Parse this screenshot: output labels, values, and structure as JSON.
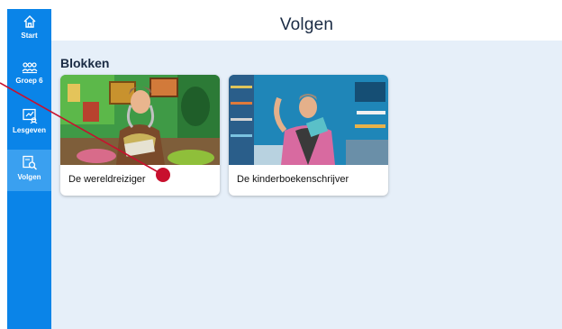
{
  "sidebar": {
    "items": [
      {
        "label": "Start",
        "icon": "home-icon"
      },
      {
        "label": "Groep 6",
        "icon": "group-icon"
      },
      {
        "label": "Lesgeven",
        "icon": "board-icon"
      },
      {
        "label": "Volgen",
        "icon": "search-doc-icon",
        "active": true
      }
    ]
  },
  "header": {
    "title": "Volgen"
  },
  "main": {
    "section_title": "Blokken",
    "cards": [
      {
        "title": "De wereldreiziger",
        "image": "woman in colorful room"
      },
      {
        "title": "De kinderboekenschrijver",
        "image": "man holding book in blue room"
      }
    ]
  },
  "colors": {
    "sidebar": "#0a84e8",
    "sidebar_active": "#3aa0f0",
    "content_bg": "#e6eff9",
    "pointer": "#c8102e"
  }
}
